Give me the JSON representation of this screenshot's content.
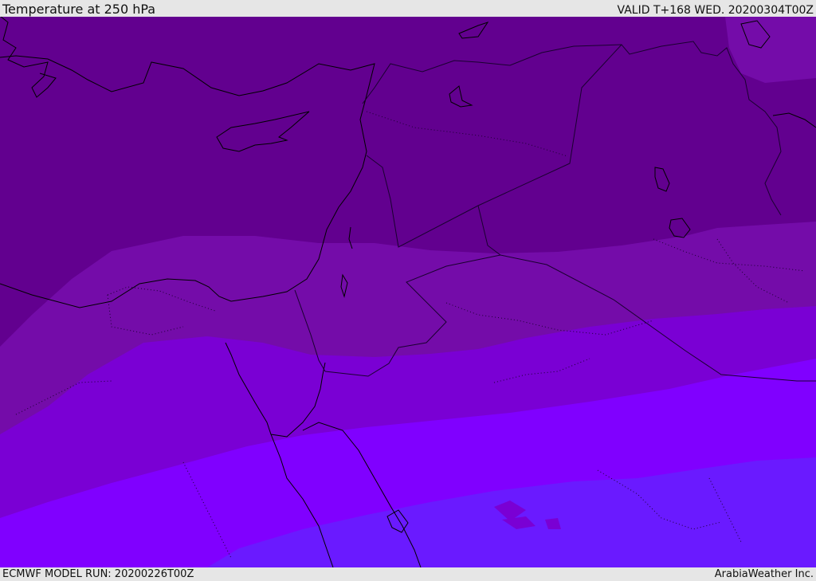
{
  "header": {
    "title": "Temperature at 250 hPa",
    "valid": "VALID T+168 WED. 20200304T00Z"
  },
  "footer": {
    "model_run": "ECMWF MODEL RUN: 20200226T00Z",
    "credit": "ArabiaWeather Inc."
  },
  "colors": {
    "band_1": "#62008f",
    "band_2": "#740ca9",
    "band_3": "#7a00d4",
    "band_4": "#8000ff",
    "band_5": "#6a1aff",
    "band_top_right": "#740ca9",
    "coastline": "#000000",
    "border": "#1a0030"
  },
  "icons": {
    "coastline": "coastline-path",
    "country-border": "dotted-border-path"
  }
}
